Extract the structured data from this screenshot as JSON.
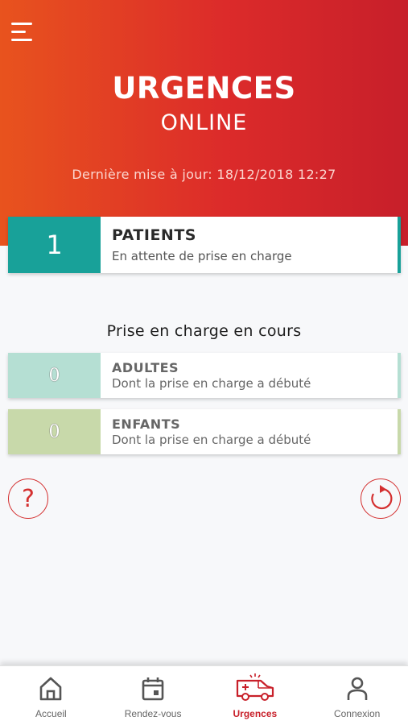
{
  "header": {
    "title": "URGENCES",
    "subtitle": "ONLINE",
    "last_update": "Dernière mise à jour: 18/12/2018 12:27"
  },
  "patients_card": {
    "count": "1",
    "label": "PATIENTS",
    "description": "En attente de prise en charge"
  },
  "in_progress": {
    "title": "Prise en charge en cours",
    "adults": {
      "count": "0",
      "label": "ADULTES",
      "description": "Dont la prise en charge a débuté"
    },
    "children": {
      "count": "0",
      "label": "ENFANTS",
      "description": "Dont la prise en charge a débuté"
    }
  },
  "actions": {
    "help_glyph": "?",
    "help_icon": "question-icon",
    "refresh_icon": "refresh-icon"
  },
  "tabs": [
    {
      "label": "Accueil",
      "icon": "home-icon",
      "active": false
    },
    {
      "label": "Rendez-vous",
      "icon": "calendar-icon",
      "active": false
    },
    {
      "label": "Urgences",
      "icon": "ambulance-icon",
      "active": true
    },
    {
      "label": "Connexion",
      "icon": "user-icon",
      "active": false
    }
  ],
  "colors": {
    "header_start": "#e8531e",
    "header_end": "#c71f2a",
    "teal": "#18a199",
    "adults": "#b5dfd3",
    "children": "#c8d9aa",
    "accent_red": "#c8202a"
  }
}
